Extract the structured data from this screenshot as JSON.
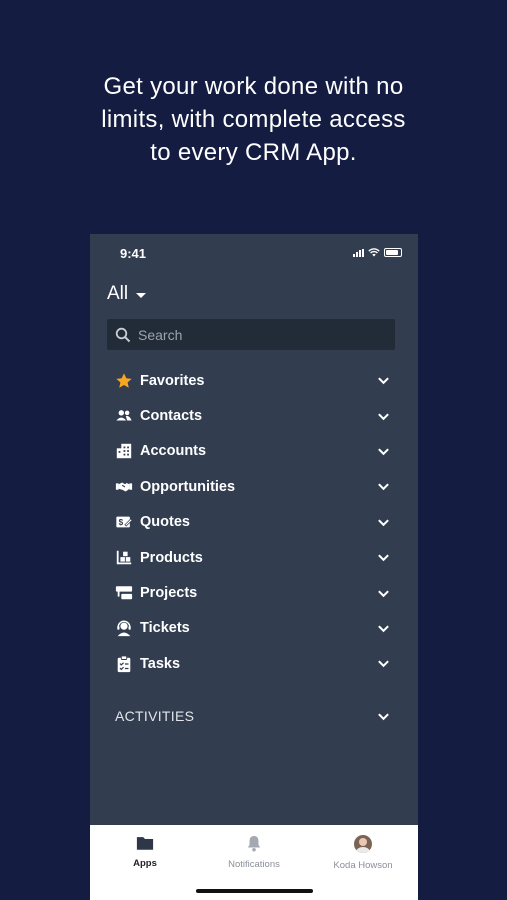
{
  "headline": [
    "Get your work done with no",
    "limits, with complete access",
    "to every CRM App."
  ],
  "status": {
    "time": "9:41"
  },
  "filter": {
    "label": "All"
  },
  "search": {
    "placeholder": "Search"
  },
  "menu": [
    {
      "label": "Favorites",
      "icon": "star-icon"
    },
    {
      "label": "Contacts",
      "icon": "contacts-icon"
    },
    {
      "label": "Accounts",
      "icon": "building-icon"
    },
    {
      "label": "Opportunities",
      "icon": "handshake-icon"
    },
    {
      "label": "Quotes",
      "icon": "quote-icon"
    },
    {
      "label": "Products",
      "icon": "products-icon"
    },
    {
      "label": "Projects",
      "icon": "projects-icon"
    },
    {
      "label": "Tickets",
      "icon": "headset-icon"
    },
    {
      "label": "Tasks",
      "icon": "clipboard-icon"
    }
  ],
  "activities": {
    "label": "ACTIVITIES"
  },
  "tabs": [
    {
      "label": "Apps",
      "icon": "folder-icon",
      "active": true
    },
    {
      "label": "Notifications",
      "icon": "bell-icon",
      "active": false
    },
    {
      "label": "Koda Howson",
      "icon": "avatar",
      "active": false
    }
  ],
  "colors": {
    "background": "#141c41",
    "panel": "#323d50",
    "star": "#f6a623"
  }
}
